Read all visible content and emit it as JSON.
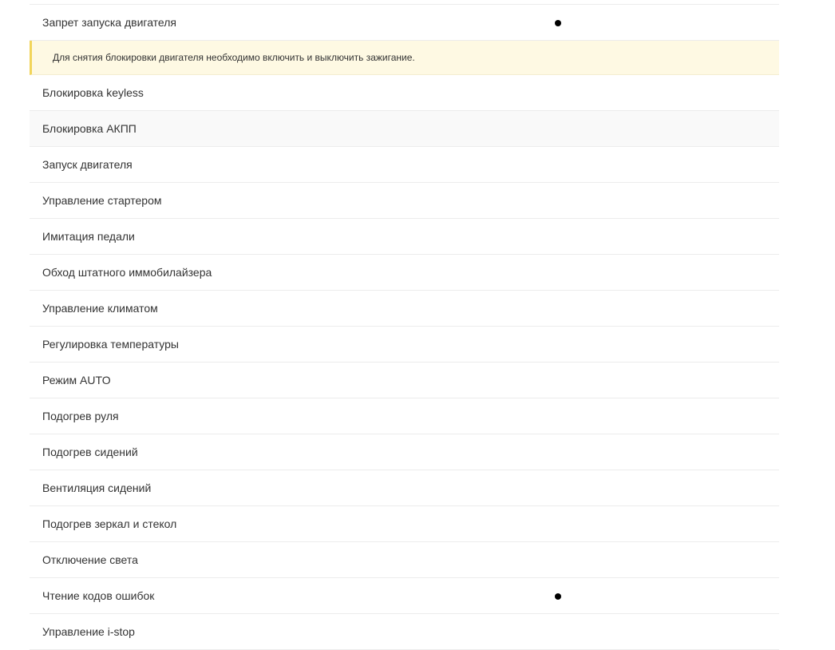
{
  "rows": [
    {
      "label": "Запрет запуска двигателя",
      "supported": true,
      "note": "Для снятия блокировки двигателя необходимо включить и выключить зажигание."
    },
    {
      "label": "Блокировка keyless",
      "supported": false
    },
    {
      "label": "Блокировка АКПП",
      "supported": false,
      "highlighted": true
    },
    {
      "label": "Запуск двигателя",
      "supported": false
    },
    {
      "label": "Управление стартером",
      "supported": false
    },
    {
      "label": "Имитация педали",
      "supported": false
    },
    {
      "label": "Обход штатного иммобилайзера",
      "supported": false
    },
    {
      "label": "Управление климатом",
      "supported": false
    },
    {
      "label": "Регулировка температуры",
      "supported": false
    },
    {
      "label": "Режим AUTO",
      "supported": false
    },
    {
      "label": "Подогрев руля",
      "supported": false
    },
    {
      "label": "Подогрев сидений",
      "supported": false
    },
    {
      "label": "Вентиляция сидений",
      "supported": false
    },
    {
      "label": "Подогрев зеркал и стекол",
      "supported": false
    },
    {
      "label": "Отключение света",
      "supported": false
    },
    {
      "label": "Чтение кодов ошибок",
      "supported": true
    },
    {
      "label": "Управление i-stop",
      "supported": false
    }
  ],
  "colors": {
    "note_background": "#fef9e3",
    "note_border": "#f2d55a",
    "row_divider": "#ececec",
    "highlight_background": "#f9f9f9"
  },
  "icons": {
    "supported_mark": "filled-circle-icon"
  }
}
